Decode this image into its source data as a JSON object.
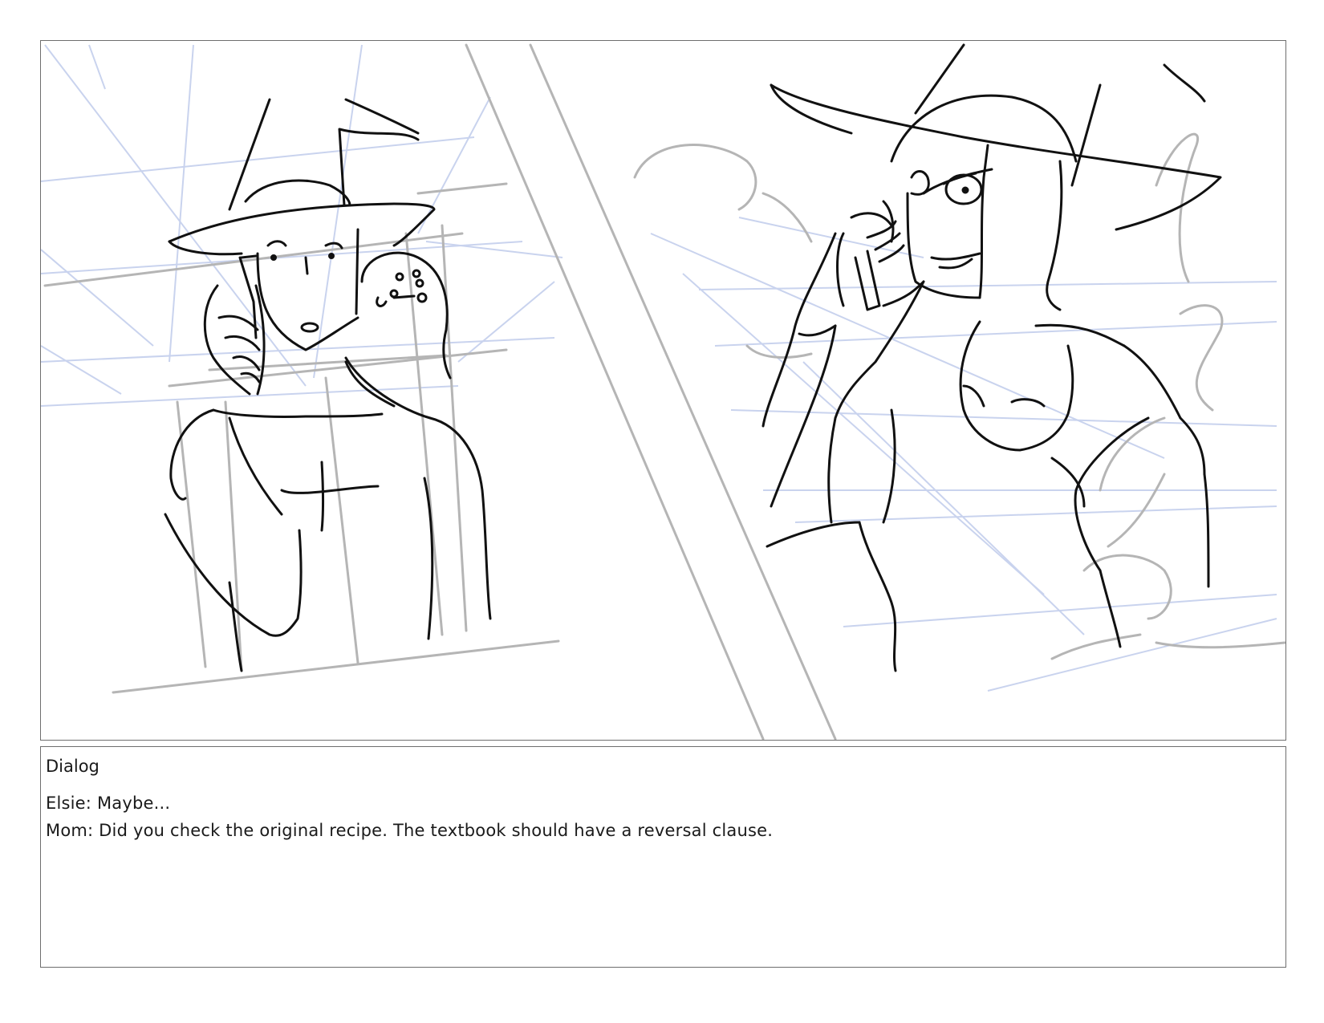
{
  "dialog": {
    "heading": "Dialog",
    "lines": [
      "Elsie: Maybe...",
      "Mom: Did you check the original recipe. The textbook should have a reversal clause."
    ]
  }
}
